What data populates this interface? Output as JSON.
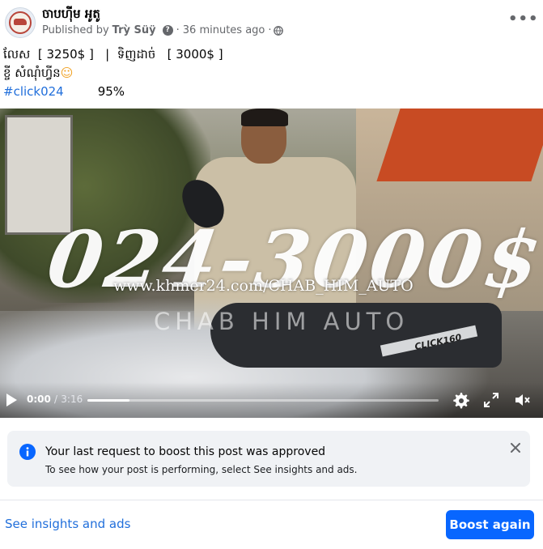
{
  "header": {
    "page_name": "ចាបហ៊ីម អូតូ",
    "published_by_label": "Published by",
    "author": "Trỳ Süÿ",
    "help_glyph": "?",
    "separator": "·",
    "time_ago": "36 minutes ago",
    "audience_icon": "globe-icon",
    "more_options": "•••"
  },
  "post": {
    "line1": "លែស  [ 3250$ ]   |  ទិញដាច់   [ 3000$ ]",
    "line2": "ខ្ចី សំណុំហ្វីន",
    "emoji": "☺",
    "hashtag": "#click024",
    "percent": "95%"
  },
  "video": {
    "overlay_price": "024-3000$",
    "overlay_url": "www.khmer24.com/CHAB_HIM_AUTO",
    "overlay_brand": "CHAB HIM AUTO",
    "bike_brand": "CLICK160",
    "current_time": "0:00",
    "time_separator": "/",
    "duration": "3:16",
    "progress_fraction": 0.12,
    "icons": [
      "play-icon",
      "settings-icon",
      "fullscreen-icon",
      "mute-icon"
    ]
  },
  "notice": {
    "icon": "info-icon",
    "title": "Your last request to boost this post was approved",
    "body": "To see how your post is performing, select See insights and ads.",
    "close_icon": "close-icon"
  },
  "footer": {
    "insights_link": "See insights and ads",
    "boost_button": "Boost again"
  },
  "colors": {
    "link_blue": "#216fdb",
    "button_blue": "#0866ff",
    "notice_bg": "#f0f2f5",
    "secondary_text": "#65676b"
  }
}
